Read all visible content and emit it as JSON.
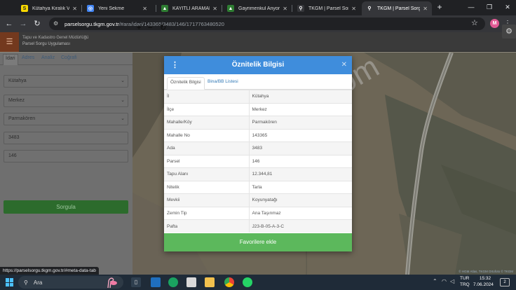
{
  "browser": {
    "tabs": [
      {
        "label": "Kütahya Kiralık Villa İ",
        "active": false,
        "favicon": "sahibinden-icon",
        "favicon_color": "#f7d800",
        "favicon_char": "S"
      },
      {
        "label": "Yeni Sekme",
        "active": false,
        "favicon": "chrome-icon",
        "favicon_color": "#4285f4",
        "favicon_char": "◎"
      },
      {
        "label": "KAYITLI ARAMALARIM",
        "active": false,
        "favicon": "tkgm-icon",
        "favicon_color": "#2e7d32",
        "favicon_char": "▲"
      },
      {
        "label": "Gayrimenkul Anyorsa",
        "active": false,
        "favicon": "tkgm-icon",
        "favicon_color": "#2e7d32",
        "favicon_char": "▲"
      },
      {
        "label": "TKGM | Parsel Sorgu",
        "active": false,
        "favicon": "map-pin-icon",
        "favicon_color": "#35363a",
        "favicon_char": "⚲"
      },
      {
        "label": "TKGM | Parsel Sorgu",
        "active": true,
        "favicon": "map-pin-icon",
        "favicon_color": "#35363a",
        "favicon_char": "⚲"
      }
    ],
    "url_host": "parselsorgu.tkgm.gov.tr",
    "url_path": "/#ara/idari/143365/3483/146/1717763480520",
    "profile_initial": "M",
    "status_url": "https://parselsorgu.tkgm.gov.tr/#meta-data-tab"
  },
  "app": {
    "title_line1": "Tapu ve Kadastro Genel Müdürlüğü",
    "title_line2": "Parsel Sorgu Uygulaması"
  },
  "sidebar": {
    "tabs": [
      "İdari",
      "Adres",
      "Analiz",
      "Coğrafi"
    ],
    "active_tab": "İdari",
    "province": "Kütahya",
    "district": "Merkez",
    "neighborhood": "Parmakören",
    "block": "3483",
    "parcel": "146",
    "search_button": "Sorgula"
  },
  "modal": {
    "title": "Öznitelik Bilgisi",
    "tabs": [
      "Öznitelik Bilgisi",
      "Bina/BB Listesi"
    ],
    "active_tab": "Öznitelik Bilgisi",
    "rows": [
      {
        "key": "İl",
        "value": "Kütahya"
      },
      {
        "key": "İlçe",
        "value": "Merkez"
      },
      {
        "key": "Mahalle/Köy",
        "value": "Parmakören"
      },
      {
        "key": "Mahalle No",
        "value": "143365"
      },
      {
        "key": "Ada",
        "value": "3483"
      },
      {
        "key": "Parsel",
        "value": "146"
      },
      {
        "key": "Tapu Alanı",
        "value": "12.344,81"
      },
      {
        "key": "Nitelik",
        "value": "Tarla"
      },
      {
        "key": "Mevkii",
        "value": "Koyunyatağı"
      },
      {
        "key": "Zemin Tip",
        "value": "Ana Taşınmaz"
      },
      {
        "key": "Pafta",
        "value": "J23-B-05-A-3-C"
      }
    ],
    "favorite_button": "Favorilere ekle"
  },
  "map": {
    "attribution": "© HGM Atlas, TKGM Ortofoto © TKGM",
    "watermark": "emlakjet.com"
  },
  "taskbar": {
    "search_placeholder": "Ara",
    "lang_line1": "TUR",
    "lang_line2": "TRQ",
    "time": "15:32",
    "date": "7.06.2024",
    "notification_count": "2"
  },
  "colors": {
    "modal_header": "#3f8ddc",
    "favorite_button": "#5cb85c",
    "search_button": "#2c6b2c",
    "menu_button": "#73391e"
  }
}
